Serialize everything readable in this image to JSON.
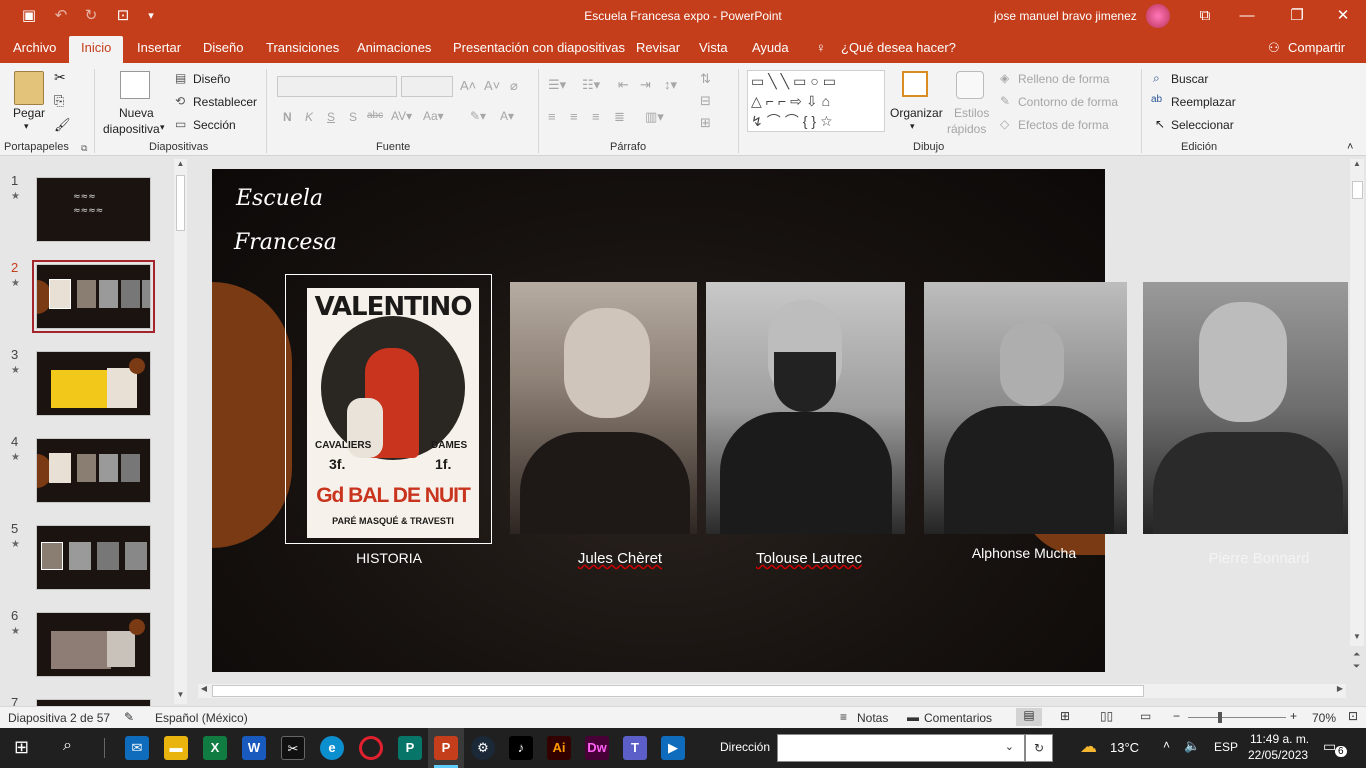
{
  "window": {
    "title": "Escuela Francesa expo  -  PowerPoint",
    "user": "jose manuel bravo jimenez"
  },
  "tabs": [
    "Archivo",
    "Inicio",
    "Insertar",
    "Diseño",
    "Transiciones",
    "Animaciones",
    "Presentación con diapositivas",
    "Revisar",
    "Vista",
    "Ayuda"
  ],
  "tell_me": "¿Qué desea hacer?",
  "share": "Compartir",
  "ribbon": {
    "clipboard": {
      "paste": "Pegar",
      "group": "Portapapeles"
    },
    "slides": {
      "new_slide_1": "Nueva",
      "new_slide_2": "diapositiva",
      "design": "Diseño",
      "reset": "Restablecer",
      "section": "Sección",
      "group": "Diapositivas"
    },
    "font": {
      "group": "Fuente",
      "bold": "N",
      "italic": "K",
      "underline": "S",
      "shadow": "S",
      "strike": "abc"
    },
    "paragraph": {
      "group": "Párrafo"
    },
    "drawing": {
      "arrange": "Organizar",
      "styles_1": "Estilos",
      "styles_2": "rápidos",
      "fill": "Relleno de forma",
      "outline": "Contorno de forma",
      "effects": "Efectos de forma",
      "group": "Dibujo"
    },
    "editing": {
      "find": "Buscar",
      "replace": "Reemplazar",
      "select": "Seleccionar",
      "group": "Edición"
    }
  },
  "thumbnails": [
    {
      "num": "1"
    },
    {
      "num": "2"
    },
    {
      "num": "3"
    },
    {
      "num": "4"
    },
    {
      "num": "5"
    },
    {
      "num": "6"
    },
    {
      "num": "7"
    }
  ],
  "slide": {
    "logo_1": "Escuela",
    "logo_2": "Francesa",
    "poster_top": "VALENTINO",
    "poster_mid_left": "CAVALIERS",
    "poster_mid_right": "DAMES",
    "poster_price_left": "3f.",
    "poster_price_right": "1f.",
    "poster_bottom": "Gd BAL DE NUIT",
    "poster_foot": "PARÉ MASQUÉ & TRAVESTI",
    "captions": [
      "HISTORIA",
      "Jules Chèret",
      "Tolouse Lautrec",
      "Alphonse Mucha",
      "Pierre Bonnard"
    ]
  },
  "status": {
    "slide_count": "Diapositiva 2 de 57",
    "language": "Español (México)",
    "notes": "Notas",
    "comments": "Comentarios",
    "zoom": "70%"
  },
  "taskbar": {
    "address_label": "Dirección",
    "weather": "13°C",
    "lang": "ESP",
    "time": "11:49 a. m.",
    "date": "22/05/2023",
    "notifications": "6"
  },
  "colors": {
    "accent": "#c43e1c",
    "brown": "#7a3a14"
  }
}
